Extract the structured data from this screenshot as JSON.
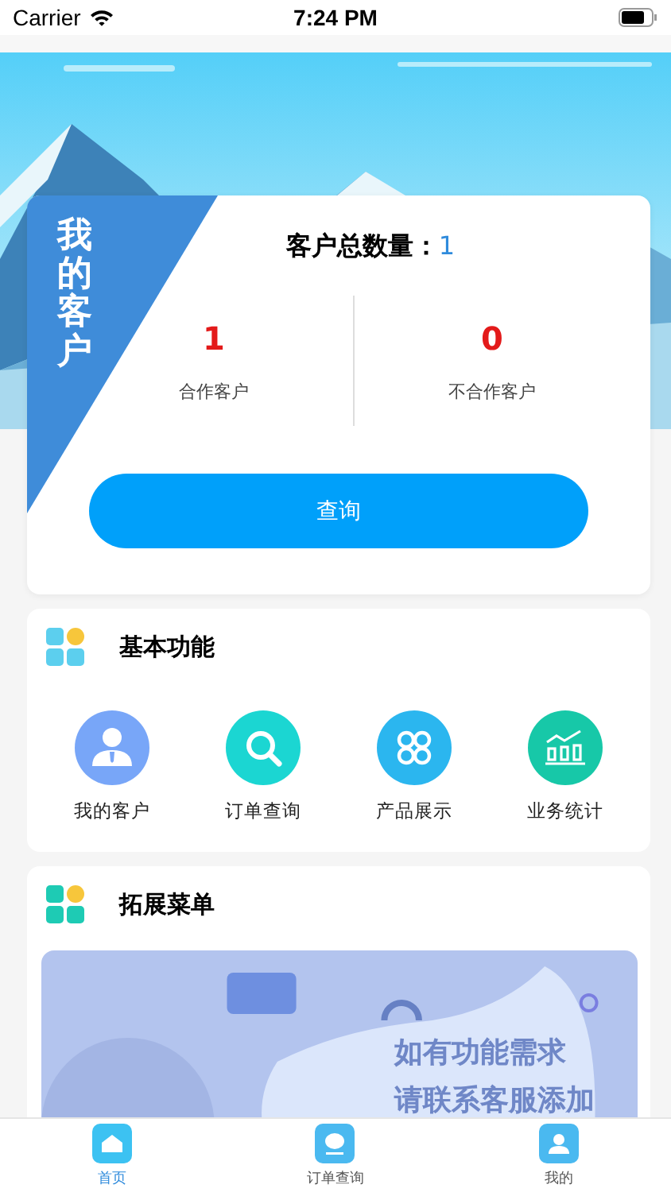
{
  "status_bar": {
    "carrier": "Carrier",
    "time": "7:24 PM"
  },
  "customer_card": {
    "ribbon": "我的客户",
    "total_label": "客户总数量：",
    "total_value": "1",
    "stats": [
      {
        "value": "1",
        "label": "合作客户"
      },
      {
        "value": "0",
        "label": "不合作客户"
      }
    ],
    "button": "查询"
  },
  "sections": [
    {
      "kind": "grid",
      "title": "基本功能",
      "color": "#5ccfee",
      "items": [
        {
          "label": "我的客户",
          "color": "#78a6f8"
        },
        {
          "label": "订单查询",
          "color": "#1bd6d2"
        },
        {
          "label": "产品展示",
          "color": "#2bb6ef"
        },
        {
          "label": "业务统计",
          "color": "#17c8a8"
        }
      ]
    },
    {
      "kind": "banner",
      "title": "拓展菜单",
      "color": "#1ecbb4",
      "banner_lines": [
        "如有功能需求",
        "请联系客服添加"
      ]
    }
  ],
  "tab_bar": [
    {
      "label": "首页",
      "selected": true
    },
    {
      "label": "订单查询",
      "selected": false
    },
    {
      "label": "我的",
      "selected": false
    }
  ]
}
